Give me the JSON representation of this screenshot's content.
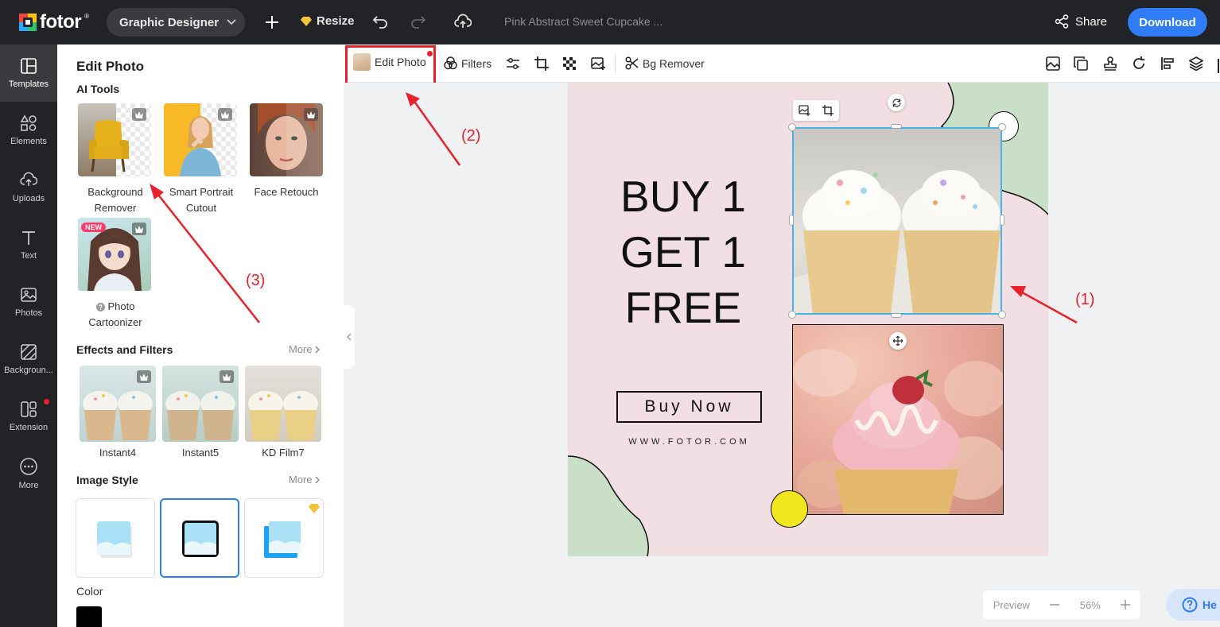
{
  "topbar": {
    "brand": "fotor",
    "mode_label": "Graphic Designer",
    "resize_label": "Resize",
    "doc_title": "Pink Abstract Sweet Cupcake ...",
    "share_label": "Share",
    "download_label": "Download"
  },
  "leftnav": {
    "items": [
      {
        "label": "Templates",
        "icon": "templates-icon"
      },
      {
        "label": "Elements",
        "icon": "elements-icon"
      },
      {
        "label": "Uploads",
        "icon": "uploads-icon"
      },
      {
        "label": "Text",
        "icon": "text-icon"
      },
      {
        "label": "Photos",
        "icon": "photos-icon"
      },
      {
        "label": "Backgroun...",
        "icon": "background-icon"
      },
      {
        "label": "Extension",
        "icon": "extension-icon"
      },
      {
        "label": "More",
        "icon": "more-icon"
      }
    ]
  },
  "panel": {
    "title": "Edit Photo",
    "ai_tools_heading": "AI Tools",
    "ai_tools": [
      {
        "label_line1": "Background",
        "label_line2": "Remover"
      },
      {
        "label_line1": "Smart Portrait",
        "label_line2": "Cutout"
      },
      {
        "label_line1": "Face Retouch",
        "label_line2": ""
      },
      {
        "label_line1": "Photo",
        "label_line2": "Cartoonizer",
        "badge": "NEW"
      }
    ],
    "effects_heading": "Effects and Filters",
    "effects_more": "More",
    "filters": [
      "Instant4",
      "Instant5",
      "KD Film7"
    ],
    "style_heading": "Image Style",
    "style_more": "More",
    "color_heading": "Color",
    "color_value": "#000000"
  },
  "toolbar": {
    "edit_photo_label": "Edit Photo",
    "filters_label": "Filters",
    "bg_remover_label": "Bg Remover"
  },
  "canvas": {
    "headline_lines": [
      "BUY 1",
      "GET 1",
      "FREE"
    ],
    "cta_label": "Buy Now",
    "website": "WWW.FOTOR.COM",
    "bg_color": "#f2dfe4",
    "accent_green": "#c9dfc8",
    "accent_yellow": "#f2e61f"
  },
  "annotations": {
    "one": "(1)",
    "two": "(2)",
    "three": "(3)"
  },
  "footer": {
    "preview_label": "Preview",
    "zoom": "56%",
    "help_label": "He"
  },
  "colors": {
    "accent_blue": "#2f7cf6",
    "annotation_red": "#e8222d",
    "dark": "#222326"
  }
}
